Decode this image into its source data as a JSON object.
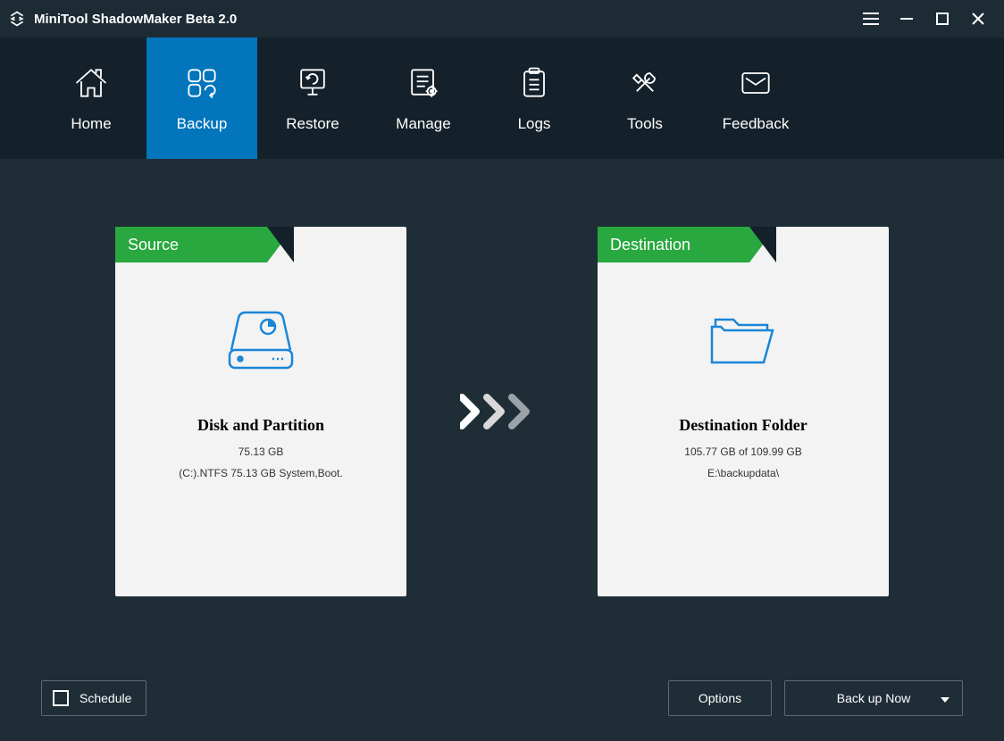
{
  "app": {
    "title": "MiniTool ShadowMaker Beta 2.0"
  },
  "nav": {
    "items": [
      {
        "label": "Home"
      },
      {
        "label": "Backup",
        "active": true
      },
      {
        "label": "Restore"
      },
      {
        "label": "Manage"
      },
      {
        "label": "Logs"
      },
      {
        "label": "Tools"
      },
      {
        "label": "Feedback"
      }
    ]
  },
  "source": {
    "header": "Source",
    "title": "Disk and Partition",
    "size": "75.13 GB",
    "detail": "(C:).NTFS 75.13 GB System,Boot."
  },
  "destination": {
    "header": "Destination",
    "title": "Destination Folder",
    "size": "105.77 GB of 109.99 GB",
    "path": "E:\\backupdata\\"
  },
  "footer": {
    "schedule": "Schedule",
    "options": "Options",
    "backup": "Back up Now"
  }
}
